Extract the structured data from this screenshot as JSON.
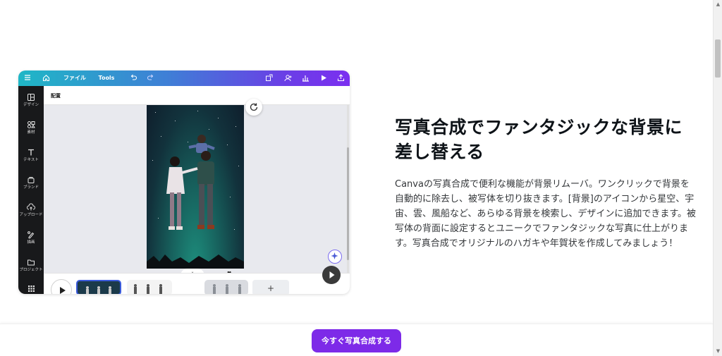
{
  "editor": {
    "topbar": {
      "file_label": "ファイル",
      "tools_label": "Tools"
    },
    "leftrail": {
      "items": [
        {
          "label": "デザイン",
          "icon": "layout-icon"
        },
        {
          "label": "素材",
          "icon": "elements-icon"
        },
        {
          "label": "テキスト",
          "icon": "text-icon"
        },
        {
          "label": "ブランド",
          "icon": "brand-icon"
        },
        {
          "label": "アップロード",
          "icon": "upload-icon"
        },
        {
          "label": "描画",
          "icon": "draw-icon"
        },
        {
          "label": "プロジェクト",
          "icon": "folder-icon"
        }
      ]
    },
    "subbar": {
      "position_label": "配置"
    },
    "timeline": {
      "add_label": "+"
    }
  },
  "section": {
    "heading_line1": "写真合成でファンタジックな背景に",
    "heading_line2": "差し替える",
    "description": "Canvaの写真合成で便利な機能が背景リムーバ。ワンクリックで背景を自動的に除去し、被写体を切り抜きます。[背景]のアイコンから星空、宇宙、雲、風船など、あらゆる背景を検索し、デザインに追加できます。被写体の背面に設定するとユニークでファンタジックな写真に仕上がります。写真合成でオリジナルのハガキや年賀状を作成してみましょう！"
  },
  "cta": {
    "label": "今すぐ写真合成する"
  },
  "colors": {
    "brand_purple": "#7d2ae8",
    "gradient_start": "#1fb7c6",
    "gradient_end": "#7b2ff0"
  }
}
